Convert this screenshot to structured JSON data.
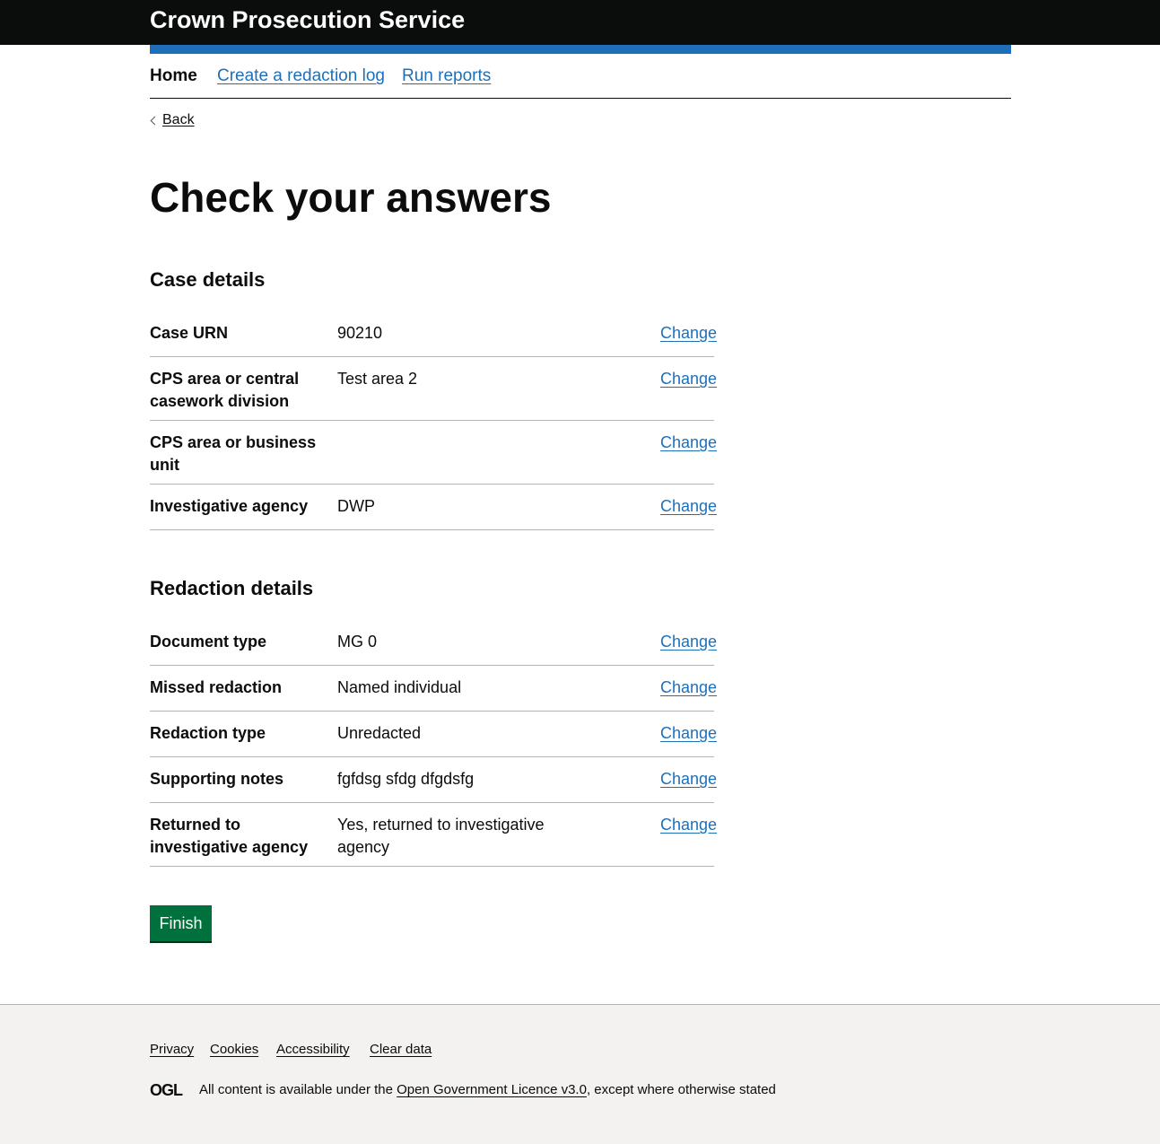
{
  "header": {
    "title": "Crown Prosecution Service"
  },
  "nav": {
    "items": [
      {
        "label": "Home"
      },
      {
        "label": "Create a redaction log"
      },
      {
        "label": "Run reports"
      }
    ]
  },
  "back_link": "Back",
  "page_title": "Check your answers",
  "case_details": {
    "heading": "Case details",
    "rows": [
      {
        "key": "Case URN",
        "value": "90210",
        "action": "Change"
      },
      {
        "key": "CPS area or central casework division",
        "value": "Test area 2",
        "action": "Change"
      },
      {
        "key": "CPS area or business unit",
        "value": "",
        "action": "Change"
      },
      {
        "key": "Investigative agency",
        "value": "DWP",
        "action": "Change"
      }
    ]
  },
  "redaction_details": {
    "heading": "Redaction details",
    "rows": [
      {
        "key": "Document type",
        "value": "MG 0",
        "action": "Change"
      },
      {
        "key": "Missed redaction",
        "value": "Named individual",
        "action": "Change"
      },
      {
        "key": "Redaction type",
        "value": "Unredacted",
        "action": "Change"
      },
      {
        "key": "Supporting notes",
        "value": "fgfdsg sfdg dfgdsfg",
        "action": "Change"
      },
      {
        "key": "Returned to investigative agency",
        "value": "Yes, returned to investigative agency",
        "action": "Change"
      }
    ]
  },
  "finish_button": "Finish",
  "footer": {
    "links": [
      {
        "label": "Privacy"
      },
      {
        "label": "Cookies"
      },
      {
        "label": "Accessibility"
      },
      {
        "label": "Clear data"
      }
    ],
    "ogl_logo": "OGL",
    "licence_prefix": "All content is available under the ",
    "licence_link": "Open Government Licence v3.0",
    "licence_suffix": ", except where otherwise stated"
  },
  "colors": {
    "header_bg": "#0b0c0c",
    "brand_blue": "#1d70b8",
    "button_green": "#00703c",
    "footer_bg": "#f3f2f1"
  }
}
